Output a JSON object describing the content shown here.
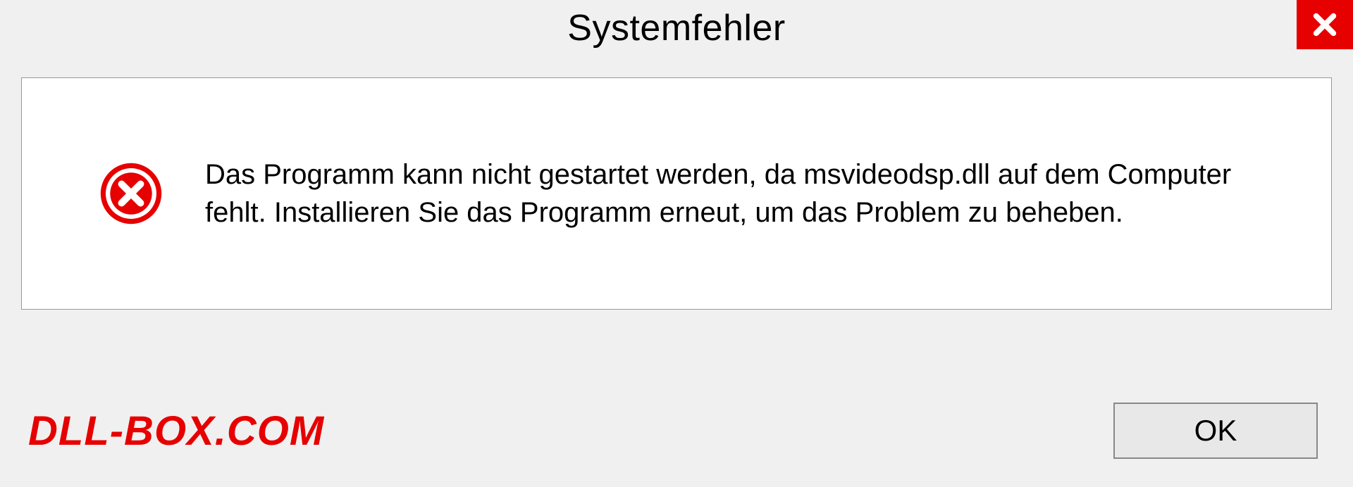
{
  "dialog": {
    "title": "Systemfehler",
    "message": "Das Programm kann nicht gestartet werden, da msvideodsp.dll auf dem Computer fehlt. Installieren Sie das Programm erneut, um das Problem zu beheben.",
    "ok_label": "OK"
  },
  "watermark": "DLL-BOX.COM"
}
